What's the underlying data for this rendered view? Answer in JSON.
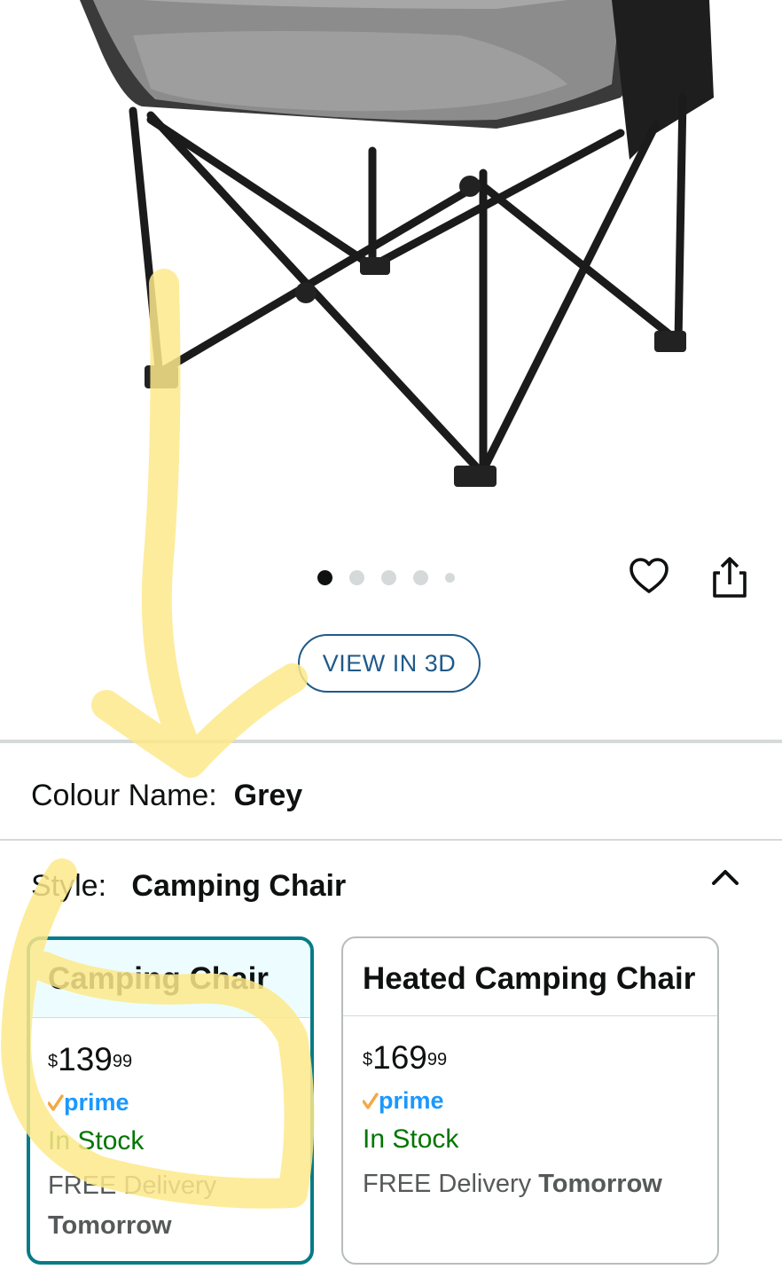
{
  "gallery": {
    "dots_total": 5,
    "active_dot_index": 0,
    "view_3d_label": "VIEW IN 3D"
  },
  "colour": {
    "label": "Colour Name:",
    "value": "Grey"
  },
  "style": {
    "label": "Style:",
    "value": "Camping Chair"
  },
  "options": [
    {
      "title": "Camping Chair",
      "price_symbol": "$",
      "price_whole": "139",
      "price_fraction": "99",
      "prime": "prime",
      "stock": "In Stock",
      "delivery_text": "FREE Delivery",
      "delivery_day": "Tomorrow",
      "selected": true
    },
    {
      "title": "Heated Camping Chair",
      "price_symbol": "$",
      "price_whole": "169",
      "price_fraction": "99",
      "prime": "prime",
      "stock": "In Stock",
      "delivery_text": "FREE Delivery",
      "delivery_day": "Tomorrow",
      "selected": false
    }
  ],
  "colors": {
    "accent_blue": "#1f5a8a",
    "selected_border": "#077b87",
    "stock_green": "#007600",
    "prime_blue": "#1a98ff",
    "prime_check": "#f3a847",
    "highlighter": "#fde98a"
  }
}
